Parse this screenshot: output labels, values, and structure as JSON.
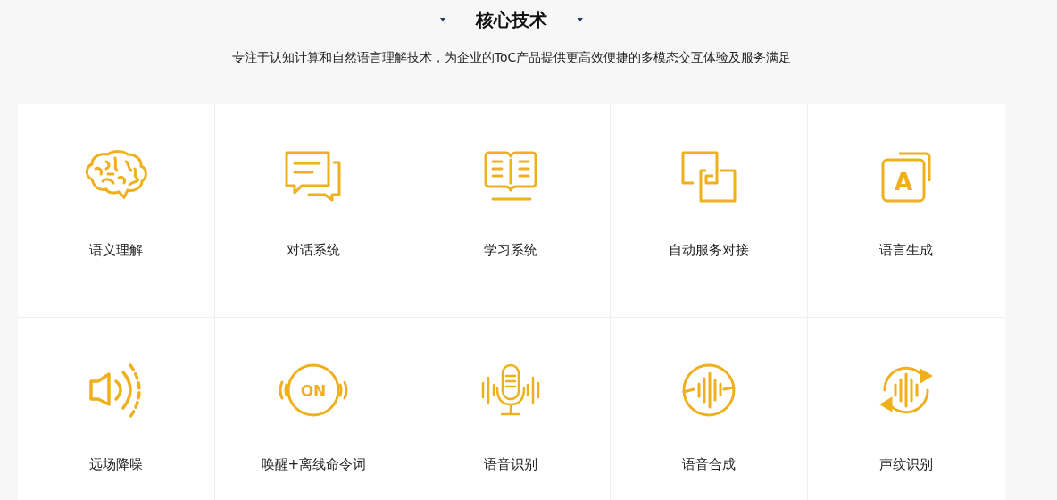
{
  "header": {
    "title": "核心技术",
    "subtitle": "专注于认知计算和自然语言理解技术，为企业的ToC产品提供更高效便捷的多模态交互体验及服务满足"
  },
  "features": [
    {
      "label": "语义理解"
    },
    {
      "label": "对话系统"
    },
    {
      "label": "学习系统"
    },
    {
      "label": "自动服务对接"
    },
    {
      "label": "语言生成",
      "icon_text": "A"
    },
    {
      "label": "远场降噪"
    },
    {
      "label": "唤醒+离线命令词",
      "icon_text": "ON"
    },
    {
      "label": "语音识别"
    },
    {
      "label": "语音合成"
    },
    {
      "label": "声纹识别"
    }
  ]
}
